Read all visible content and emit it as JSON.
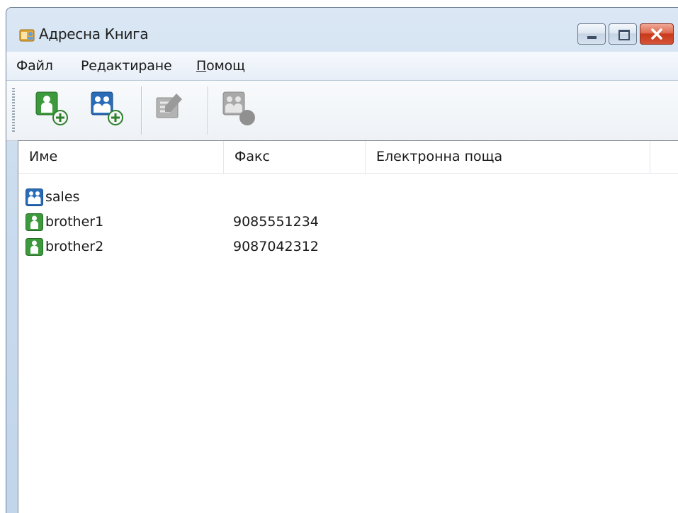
{
  "window": {
    "title": "Адресна Книга"
  },
  "menu": [
    {
      "label": "Файл"
    },
    {
      "label": "Редактиране"
    },
    {
      "label": "Помощ"
    }
  ],
  "toolbar": {
    "buttons": [
      {
        "icon": "add-member-icon",
        "enabled": true
      },
      {
        "icon": "add-group-icon",
        "enabled": true
      },
      {
        "icon": "edit-icon",
        "enabled": false
      },
      {
        "icon": "delete-icon",
        "enabled": false
      }
    ]
  },
  "table": {
    "columns": [
      "Име",
      "Факс",
      "Електронна поща"
    ],
    "rows": [
      {
        "type": "group",
        "name": "sales",
        "fax": "",
        "email": ""
      },
      {
        "type": "member",
        "name": "brother1",
        "fax": "9085551234",
        "email": ""
      },
      {
        "type": "member",
        "name": "brother2",
        "fax": "9087042312",
        "email": ""
      }
    ]
  },
  "colors": {
    "group": "#2b6cb8",
    "member": "#3c9a3c",
    "accent": "#c8391a"
  }
}
